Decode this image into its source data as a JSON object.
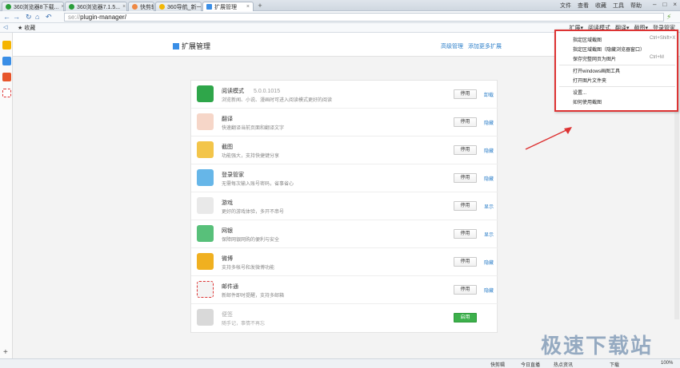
{
  "tabs": [
    {
      "label": "360浏览器8下载..."
    },
    {
      "label": "360浏览器7.1.5..."
    },
    {
      "label": "快剪辑"
    },
    {
      "label": "360导航_新一..."
    },
    {
      "label": "扩展管理"
    }
  ],
  "menus": [
    "文件",
    "查看",
    "收藏",
    "工具",
    "帮助"
  ],
  "url": {
    "scheme": "se://",
    "path": "plugin-manager/"
  },
  "favbar": {
    "label": "收藏"
  },
  "tools": [
    "扩展",
    "阅读模式",
    "翻译",
    "截图",
    "登录管家"
  ],
  "page": {
    "title": "扩展管理",
    "manage_link": "高级管理",
    "add_link": "添加更多扩展"
  },
  "extensions": [
    {
      "name": "阅读模式",
      "version": "5.0.0.1015",
      "desc": "浏览新闻、小说、漫画时可进入阅读模式更好的阅读",
      "button": "停用",
      "link": "卸载",
      "color": "#2fa64a"
    },
    {
      "name": "翻译",
      "version": "",
      "desc": "快速翻译当前页面和翻译文字",
      "button": "停用",
      "link": "隐藏",
      "color": "#f6d6c8"
    },
    {
      "name": "截图",
      "version": "",
      "desc": "功能强大，支持快捷键分享",
      "button": "停用",
      "link": "隐藏",
      "color": "#f3c54a"
    },
    {
      "name": "登录管家",
      "version": "",
      "desc": "无需每次输入账号密码，省事省心",
      "button": "停用",
      "link": "隐藏",
      "color": "#66b6e8"
    },
    {
      "name": "游戏",
      "version": "",
      "desc": "更好的游戏体验，多开不串号",
      "button": "停用",
      "link": "显示",
      "color": "#e9e9e9"
    },
    {
      "name": "网银",
      "version": "",
      "desc": "保障网银网购的便利与安全",
      "button": "停用",
      "link": "显示",
      "color": "#58c07a"
    },
    {
      "name": "微博",
      "version": "",
      "desc": "支持多帐号和发微博功能",
      "button": "停用",
      "link": "隐藏",
      "color": "#f0b020"
    },
    {
      "name": "邮件通",
      "version": "",
      "desc": "新邮件即时提醒，支持多邮箱",
      "button": "停用",
      "link": "隐藏",
      "color": "#f4f4f4"
    },
    {
      "name": "便签",
      "version": "",
      "desc": "随手记，事情不再忘",
      "button": "启用",
      "link": "",
      "color": "#d9d9d9"
    }
  ],
  "dropdown": [
    {
      "label": "指定区域截图",
      "shortcut": "Ctrl+Shift+X"
    },
    {
      "label": "指定区域截图（隐藏浏览器窗口）",
      "shortcut": ""
    },
    {
      "label": "保存完整网页为图片",
      "shortcut": "Ctrl+M"
    },
    {
      "label": "打开windows画图工具",
      "shortcut": ""
    },
    {
      "label": "打开图片文件夹",
      "shortcut": ""
    },
    {
      "label": "设置...",
      "shortcut": ""
    },
    {
      "label": "如何使用截图",
      "shortcut": ""
    }
  ],
  "status": {
    "items": [
      "快剪辑",
      "今日直播",
      "热点资讯",
      "下载",
      "100%"
    ]
  },
  "watermark": "极速下载站",
  "colors": {
    "highlight": "#dd3333",
    "link": "#2d7fc9",
    "enable": "#3cb04b"
  }
}
